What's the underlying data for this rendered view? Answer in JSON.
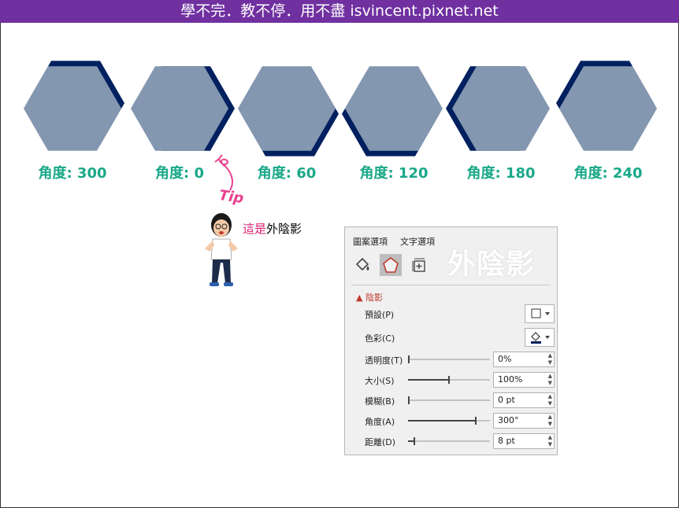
{
  "banner": {
    "text": "學不完．教不停．用不盡 isvincent.pixnet.net"
  },
  "hexagons": [
    {
      "caption": "角度: 300"
    },
    {
      "caption": "角度: 0"
    },
    {
      "caption": "角度: 60"
    },
    {
      "caption": "角度: 120"
    },
    {
      "caption": "角度: 180"
    },
    {
      "caption": "角度: 240"
    }
  ],
  "colors": {
    "hex_fill": "#8497b0",
    "shadow": "#00205f",
    "caption": "#1aa889",
    "banner": "#7030a0",
    "tip": "#e8418f"
  },
  "tip": {
    "badge": "Tip",
    "note_prefix": "這是",
    "note_main": "外陰影"
  },
  "panel": {
    "tabs": [
      "圖案選項",
      "文字選項"
    ],
    "icons": [
      "fill-bucket-icon",
      "pentagon-effects-icon",
      "size-layout-icon"
    ],
    "title": "外陰影",
    "section": "陰影",
    "preset_label": "預設(P)",
    "color_label": "色彩(C)",
    "rows": [
      {
        "label": "透明度(T)",
        "value": "0%",
        "level": 0.0
      },
      {
        "label": "大小(S)",
        "value": "100%",
        "level": 0.5
      },
      {
        "label": "模糊(B)",
        "value": "0 pt",
        "level": 0.0
      },
      {
        "label": "角度(A)",
        "value": "300°",
        "level": 0.83
      },
      {
        "label": "距離(D)",
        "value": "8 pt",
        "level": 0.08
      }
    ]
  }
}
